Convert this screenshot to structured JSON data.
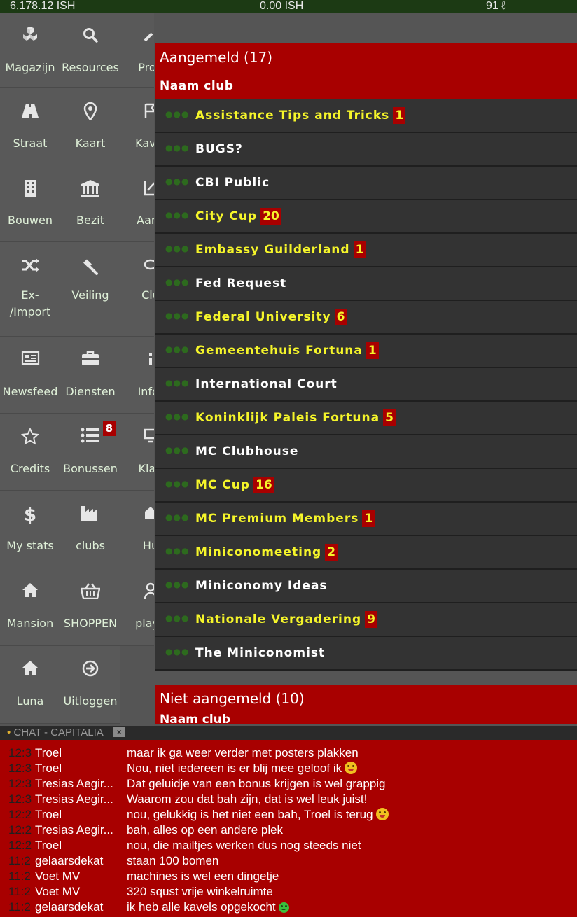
{
  "topbar": {
    "balance": "6,178.12 ISH",
    "center_amount": "0.00 ISH",
    "right_amount": "91 ℓ"
  },
  "menu": {
    "tiles": [
      {
        "label": "Magazijn",
        "icon": "boxes-icon"
      },
      {
        "label": "Resources",
        "icon": "search-icon"
      },
      {
        "label": "Prod",
        "icon": "wrench-icon"
      },
      {
        "label": "Straat",
        "icon": "road-icon"
      },
      {
        "label": "Kaart",
        "icon": "map-pin-icon"
      },
      {
        "label": "Kavel",
        "icon": "flag-icon"
      },
      {
        "label": "Bouwen",
        "icon": "building-icon"
      },
      {
        "label": "Bezit",
        "icon": "bank-icon"
      },
      {
        "label": "Aanc",
        "icon": "chart-icon"
      },
      {
        "label": "Ex-",
        "label2": "/Import",
        "icon": "shuffle-icon"
      },
      {
        "label": "Veiling",
        "icon": "gavel-icon"
      },
      {
        "label": "Clu",
        "icon": "chat-bubble-icon"
      },
      {
        "label": "Newsfeed",
        "icon": "newspaper-icon"
      },
      {
        "label": "Diensten",
        "icon": "briefcase-icon"
      },
      {
        "label": "Infor",
        "icon": "info-icon"
      },
      {
        "label": "Credits",
        "icon": "star-icon"
      },
      {
        "label": "Bonussen",
        "icon": "list-icon",
        "badge": "8"
      },
      {
        "label": "Klad",
        "icon": "monitor-icon"
      },
      {
        "label": "My stats",
        "icon": "dollar-icon"
      },
      {
        "label": "clubs",
        "icon": "factory-icon"
      },
      {
        "label": "Hu",
        "icon": "house-icon"
      },
      {
        "label": "Mansion",
        "icon": "home-icon"
      },
      {
        "label": "SHOPPEN",
        "icon": "basket-icon"
      },
      {
        "label": "playe",
        "icon": "user-icon"
      },
      {
        "label": "Luna",
        "icon": "home-icon"
      },
      {
        "label": "Uitloggen",
        "icon": "arrow-circle-right-icon"
      }
    ]
  },
  "clubs": {
    "signed_in_title": "Aangemeld (17)",
    "column_header": "Naam club",
    "signed_in": [
      {
        "name": "Assistance Tips and Tricks",
        "count": "1"
      },
      {
        "name": "BUGS?",
        "count": ""
      },
      {
        "name": "CBI Public",
        "count": ""
      },
      {
        "name": "City Cup",
        "count": "20"
      },
      {
        "name": "Embassy Guilderland",
        "count": "1"
      },
      {
        "name": "Fed Request",
        "count": ""
      },
      {
        "name": "Federal University",
        "count": "6"
      },
      {
        "name": "Gemeentehuis Fortuna",
        "count": "1"
      },
      {
        "name": "International Court",
        "count": ""
      },
      {
        "name": "Koninklijk Paleis Fortuna",
        "count": "5"
      },
      {
        "name": "MC Clubhouse",
        "count": ""
      },
      {
        "name": "MC Cup",
        "count": "16"
      },
      {
        "name": "MC Premium Members",
        "count": "1"
      },
      {
        "name": "Miniconomeeting",
        "count": "2"
      },
      {
        "name": "Miniconomy Ideas",
        "count": ""
      },
      {
        "name": "Nationale Vergadering",
        "count": "9"
      },
      {
        "name": "The Miniconomist",
        "count": ""
      }
    ],
    "not_signed_in_title": "Niet aangemeld (10)",
    "not_signed_in_column_header": "Naam club"
  },
  "chat": {
    "title": "CHAT - CAPITALIA",
    "close_label": "×",
    "messages": [
      {
        "time": "12:3",
        "user": "Troel",
        "text": "maar ik ga weer verder met posters plakken",
        "emoji": ""
      },
      {
        "time": "12:3",
        "user": "Troel",
        "text": "Nou, niet iedereen is er blij mee geloof ik",
        "emoji": "tongue"
      },
      {
        "time": "12:3",
        "user": "Tresias Aegir...",
        "text": "Dat geluidje van een bonus krijgen is wel grappig",
        "emoji": ""
      },
      {
        "time": "12:3",
        "user": "Tresias Aegir...",
        "text": "Waarom zou dat bah zijn, dat is wel leuk juist!",
        "emoji": ""
      },
      {
        "time": "12:2",
        "user": "Troel",
        "text": "nou, gelukkig is het niet een bah, Troel is terug",
        "emoji": "tongue"
      },
      {
        "time": "12:2",
        "user": "Tresias Aegir...",
        "text": "bah, alles op een andere plek",
        "emoji": ""
      },
      {
        "time": "12:2",
        "user": "Troel",
        "text": "nou, die mailtjes werken dus nog steeds niet",
        "emoji": ""
      },
      {
        "time": "11:2",
        "user": "gelaarsdekat",
        "text": "staan 100 bomen",
        "emoji": ""
      },
      {
        "time": "11:2",
        "user": "Voet MV",
        "text": "machines is wel een dingetje",
        "emoji": ""
      },
      {
        "time": "11:2",
        "user": "Voet MV",
        "text": "320 squst vrije winkelruimte",
        "emoji": ""
      },
      {
        "time": "11:2",
        "user": "gelaarsdekat",
        "text": "ik heb alle kavels opgekocht",
        "emoji": "green-smile"
      }
    ]
  }
}
